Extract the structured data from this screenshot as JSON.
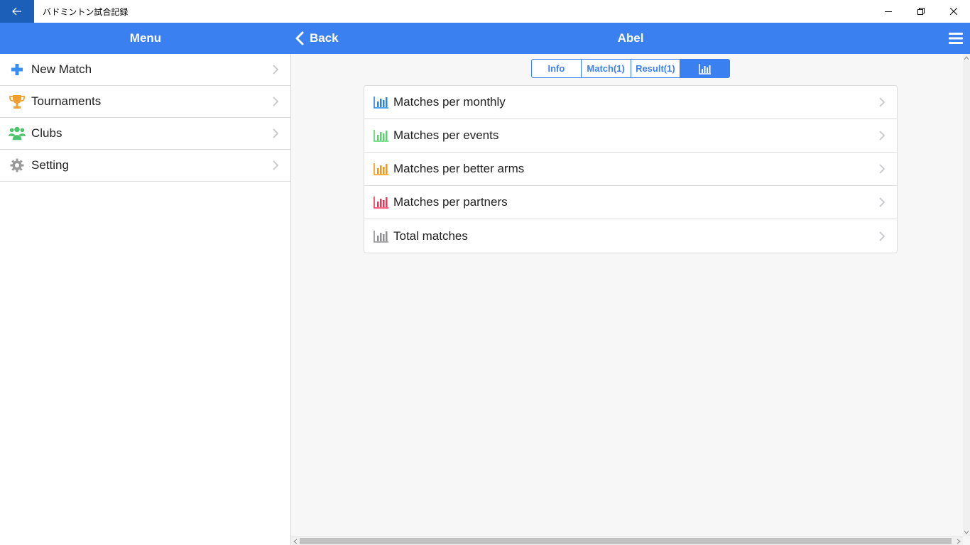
{
  "window": {
    "title": "バドミントン試合記録"
  },
  "header": {
    "menu_title": "Menu",
    "back_label": "Back",
    "page_title": "Abel"
  },
  "sidebar": {
    "items": [
      {
        "label": "New Match",
        "icon": "plus-icon",
        "color": "#3b8ef0"
      },
      {
        "label": "Tournaments",
        "icon": "trophy-icon",
        "color": "#f0a030"
      },
      {
        "label": "Clubs",
        "icon": "people-icon",
        "color": "#4cc46a"
      },
      {
        "label": "Setting",
        "icon": "gear-icon",
        "color": "#999999"
      }
    ]
  },
  "tabs": [
    {
      "label": "Info",
      "active": false
    },
    {
      "label": "Match(1)",
      "active": false
    },
    {
      "label": "Result(1)",
      "active": false
    },
    {
      "label": "",
      "icon": "bar-chart-icon",
      "active": true
    }
  ],
  "stats_list": [
    {
      "label": "Matches per monthly",
      "icon_color": "#1e88e5"
    },
    {
      "label": "Matches per events",
      "icon_color": "#4cd964"
    },
    {
      "label": "Matches per better arms",
      "icon_color": "#ff9500"
    },
    {
      "label": "Matches per partners",
      "icon_color": "#ff2d55"
    },
    {
      "label": "Total matches",
      "icon_color": "#8e8e93"
    }
  ],
  "colors": {
    "accent": "#3b80f0"
  }
}
